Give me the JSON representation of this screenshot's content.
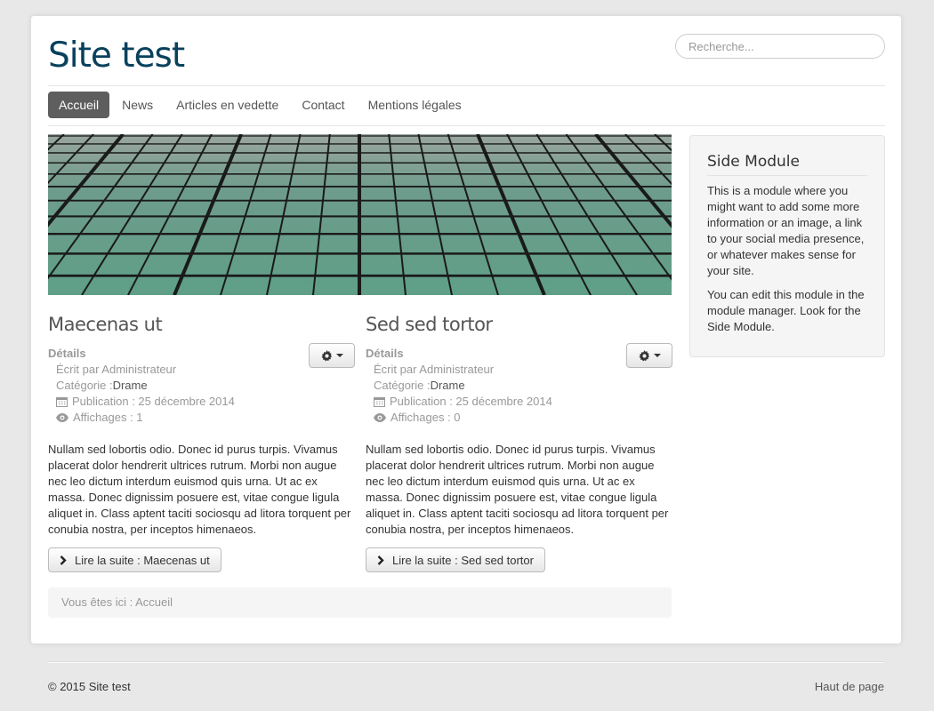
{
  "header": {
    "site_title": "Site test",
    "search_placeholder": "Recherche..."
  },
  "nav": {
    "items": [
      {
        "label": "Accueil",
        "active": true
      },
      {
        "label": "News",
        "active": false
      },
      {
        "label": "Articles en vedette",
        "active": false
      },
      {
        "label": "Contact",
        "active": false
      },
      {
        "label": "Mentions légales",
        "active": false
      }
    ]
  },
  "articles": [
    {
      "title": "Maecenas ut",
      "details_label": "Détails",
      "author": "Écrit par Administrateur",
      "category_label": "Catégorie : ",
      "category": "Drame",
      "published": "Publication : 25 décembre 2014",
      "hits": "Affichages : 1",
      "body": "Nullam sed lobortis odio. Donec id purus turpis. Vivamus placerat dolor hendrerit ultrices rutrum. Morbi non augue nec leo dictum interdum euismod quis urna. Ut ac ex massa. Donec dignissim posuere est, vitae congue ligula aliquet in. Class aptent taciti sociosqu ad litora torquent per conubia nostra, per inceptos himenaeos.",
      "readmore": "Lire la suite : Maecenas ut"
    },
    {
      "title": "Sed sed tortor",
      "details_label": "Détails",
      "author": "Écrit par Administrateur",
      "category_label": "Catégorie : ",
      "category": "Drame",
      "published": "Publication : 25 décembre 2014",
      "hits": "Affichages : 0",
      "body": "Nullam sed lobortis odio. Donec id purus turpis. Vivamus placerat dolor hendrerit ultrices rutrum. Morbi non augue nec leo dictum interdum euismod quis urna. Ut ac ex massa. Donec dignissim posuere est, vitae congue ligula aliquet in. Class aptent taciti sociosqu ad litora torquent per conubia nostra, per inceptos himenaeos.",
      "readmore": "Lire la suite : Sed sed tortor"
    }
  ],
  "breadcrumb": {
    "prefix": "Vous êtes ici : ",
    "current": "Accueil"
  },
  "side_module": {
    "title": "Side Module",
    "para1": "This is a module where you might want to add some more information or an image, a link to your social media presence, or whatever makes sense for your site.",
    "para2": "You can edit this module in the module manager. Look for the Side Module."
  },
  "footer": {
    "copyright": "© 2015 Site test",
    "back_to_top": "Haut de page"
  },
  "icons": {
    "gear": "gear-icon",
    "calendar": "calendar-icon",
    "eye": "eye-icon",
    "chevron": "chevron-right-icon"
  },
  "colors": {
    "site_title": "#08415c",
    "nav_active_bg": "#5e5e5e",
    "page_bg": "#e8e8e8"
  }
}
